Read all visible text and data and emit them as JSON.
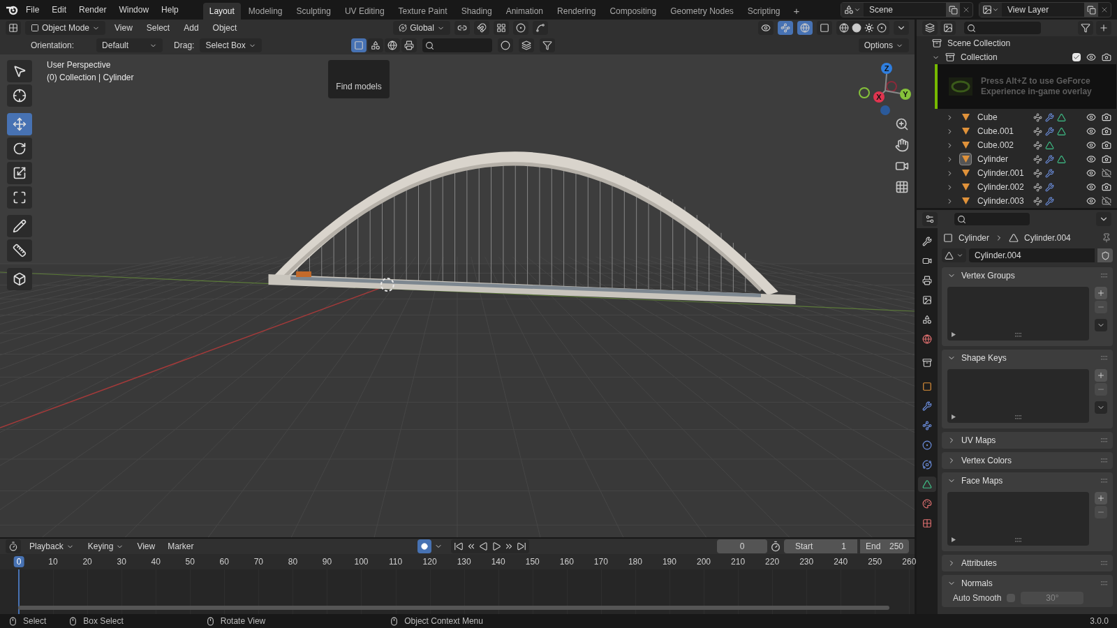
{
  "menu": [
    "File",
    "Edit",
    "Render",
    "Window",
    "Help"
  ],
  "workspaces": [
    {
      "label": "Layout",
      "selected": true
    },
    {
      "label": "Modeling",
      "selected": false
    },
    {
      "label": "Sculpting",
      "selected": false
    },
    {
      "label": "UV Editing",
      "selected": false
    },
    {
      "label": "Texture Paint",
      "selected": false
    },
    {
      "label": "Shading",
      "selected": false
    },
    {
      "label": "Animation",
      "selected": false
    },
    {
      "label": "Rendering",
      "selected": false
    },
    {
      "label": "Compositing",
      "selected": false
    },
    {
      "label": "Geometry Nodes",
      "selected": false
    },
    {
      "label": "Scripting",
      "selected": false
    }
  ],
  "add_workspace": "+",
  "scene": "Scene",
  "view_layer": "View Layer",
  "viewport": {
    "mode": "Object Mode",
    "menus": [
      "View",
      "Select",
      "Add",
      "Object"
    ],
    "transform_orientation": "Global",
    "orientation_label": "Orientation:",
    "orientation": "Default",
    "drag_label": "Drag:",
    "drag": "Select Box",
    "options": "Options",
    "view_name": "User Perspective",
    "context": "(0) Collection | Cylinder",
    "tooltip": "Find models",
    "tools": [
      {
        "selected": false
      },
      {
        "selected": false
      },
      {
        "selected": true
      },
      {
        "selected": false
      },
      {
        "selected": false
      },
      {
        "selected": false
      },
      {
        "selected": false
      },
      {
        "selected": false
      },
      {
        "selected": false
      }
    ],
    "gizmo_axes": [
      {
        "label": "Z",
        "color": "#2f7fe0"
      },
      {
        "label": "X",
        "color": "#e0344f"
      },
      {
        "label": "Y",
        "color": "#85c23a"
      }
    ]
  },
  "outliner": {
    "root": "Scene Collection",
    "collection": {
      "name": "Collection",
      "expanded": true,
      "checked": true
    },
    "objects": [
      {
        "name": "Cube",
        "selected": false,
        "modifier": true,
        "mesh_data": true,
        "render_enabled": true
      },
      {
        "name": "Cube.001",
        "selected": false,
        "modifier": true,
        "mesh_data": true,
        "render_enabled": true
      },
      {
        "name": "Cube.002",
        "selected": false,
        "modifier": false,
        "mesh_data": true,
        "render_enabled": true
      },
      {
        "name": "Cylinder",
        "selected": true,
        "modifier": true,
        "mesh_data": true,
        "render_enabled": true
      },
      {
        "name": "Cylinder.001",
        "selected": false,
        "modifier": true,
        "mesh_data": false,
        "render_enabled": false
      },
      {
        "name": "Cylinder.002",
        "selected": false,
        "modifier": true,
        "mesh_data": false,
        "render_enabled": true
      },
      {
        "name": "Cylinder.003",
        "selected": false,
        "modifier": true,
        "mesh_data": false,
        "render_enabled": false
      }
    ]
  },
  "overlay": {
    "message": "Press Alt+Z to use GeForce Experience in-game overlay"
  },
  "properties": {
    "tabs": [
      {
        "selected": false
      },
      {
        "selected": false
      },
      {
        "selected": false
      },
      {
        "selected": false
      },
      {
        "selected": false
      },
      {
        "selected": false
      },
      {
        "selected": false
      },
      {
        "selected": false
      },
      {
        "selected": false
      },
      {
        "selected": false
      },
      {
        "selected": false
      },
      {
        "selected": false
      },
      {
        "selected": true
      },
      {
        "selected": false
      },
      {
        "selected": false
      }
    ],
    "object": "Cylinder",
    "data": "Cylinder.004",
    "mesh_name": "Cylinder.004",
    "panels": [
      {
        "title": "Vertex Groups",
        "expanded": true,
        "kind": "list",
        "menu": true
      },
      {
        "title": "Shape Keys",
        "expanded": true,
        "kind": "list",
        "menu": true
      },
      {
        "title": "UV Maps",
        "expanded": false
      },
      {
        "title": "Vertex Colors",
        "expanded": false
      },
      {
        "title": "Face Maps",
        "expanded": true,
        "kind": "list",
        "menu": false
      },
      {
        "title": "Attributes",
        "expanded": false
      },
      {
        "title": "Normals",
        "expanded": true,
        "kind": "normals"
      }
    ],
    "auto_smooth": {
      "label": "Auto Smooth",
      "checked": false,
      "angle": "30°"
    }
  },
  "timeline": {
    "menus": [
      "Playback",
      "Keying",
      "View",
      "Marker"
    ],
    "record": true,
    "current": "0",
    "start_label": "Start",
    "start": "1",
    "end_label": "End",
    "end": "250",
    "frames": [
      {
        "label": "0",
        "selected": true
      },
      {
        "label": "10",
        "selected": false
      },
      {
        "label": "20",
        "selected": false
      },
      {
        "label": "30",
        "selected": false
      },
      {
        "label": "40",
        "selected": false
      },
      {
        "label": "50",
        "selected": false
      },
      {
        "label": "60",
        "selected": false
      },
      {
        "label": "70",
        "selected": false
      },
      {
        "label": "80",
        "selected": false
      },
      {
        "label": "90",
        "selected": false
      },
      {
        "label": "100",
        "selected": false
      },
      {
        "label": "110",
        "selected": false
      },
      {
        "label": "120",
        "selected": false
      },
      {
        "label": "130",
        "selected": false
      },
      {
        "label": "140",
        "selected": false
      },
      {
        "label": "150",
        "selected": false
      },
      {
        "label": "160",
        "selected": false
      },
      {
        "label": "170",
        "selected": false
      },
      {
        "label": "180",
        "selected": false
      },
      {
        "label": "190",
        "selected": false
      },
      {
        "label": "200",
        "selected": false
      },
      {
        "label": "210",
        "selected": false
      },
      {
        "label": "220",
        "selected": false
      },
      {
        "label": "230",
        "selected": false
      },
      {
        "label": "240",
        "selected": false
      },
      {
        "label": "250",
        "selected": false
      },
      {
        "label": "260",
        "selected": false
      }
    ]
  },
  "status": {
    "hints": [
      "Select",
      "Box Select",
      "Rotate View",
      "Object Context Menu"
    ],
    "version": "3.0.0"
  }
}
